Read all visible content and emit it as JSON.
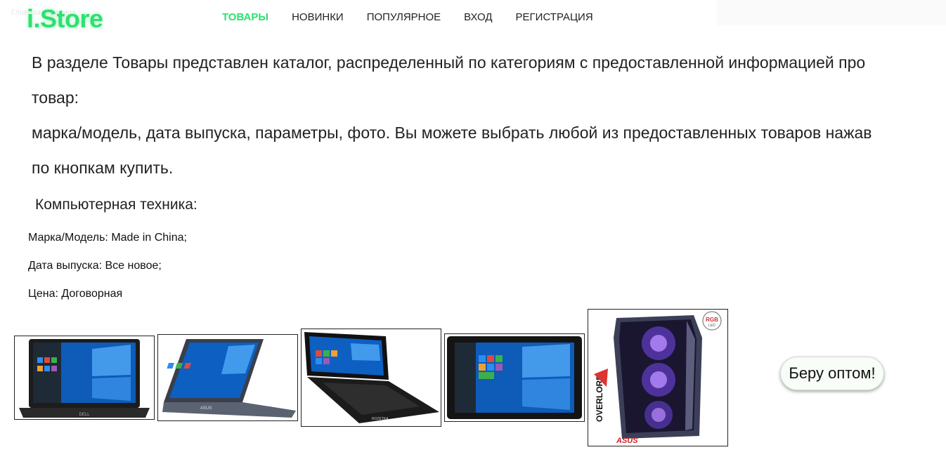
{
  "header": {
    "ghost_text": "Главная страница",
    "logo": "i.Store",
    "nav": [
      {
        "label": "ТОВАРЫ",
        "active": true
      },
      {
        "label": "НОВИНКИ",
        "active": false
      },
      {
        "label": "ПОПУЛЯРНОЕ",
        "active": false
      },
      {
        "label": "ВХОД",
        "active": false
      },
      {
        "label": "РЕГИСТРАЦИЯ",
        "active": false
      }
    ]
  },
  "intro": {
    "line1": "В разделе Товары представлен каталог, распределенный по категориям с предоставленной информацией про",
    "line2": "товар:",
    "line3": "марка/модель, дата выпуска, параметры, фото. Вы можете выбрать любой из предоставленных товаров нажав",
    "line4": "по кнопкам купить."
  },
  "category": {
    "title": "Компьютерная техника:",
    "brand": "Марка/Модель: Made in China;",
    "release": "Дата выпуска: Все новое;",
    "price": "Цена: Договорная"
  },
  "products": [
    {
      "name": "laptop-dell",
      "brand_mark": "DELL"
    },
    {
      "name": "laptop-asus-convertible",
      "brand_mark": "ASUS"
    },
    {
      "name": "tablet-keyboard",
      "brand_mark": "ROZETKA"
    },
    {
      "name": "tablet",
      "brand_mark": ""
    },
    {
      "name": "pc-case",
      "brand_mark": "OVERLORD",
      "badge": "RGB",
      "badge_sub": "LED",
      "maker": "ASUS"
    }
  ],
  "bulk_button": "Беру оптом!",
  "colors": {
    "accent": "#2fe070",
    "text": "#222222",
    "win_blue": "#1565c0"
  }
}
